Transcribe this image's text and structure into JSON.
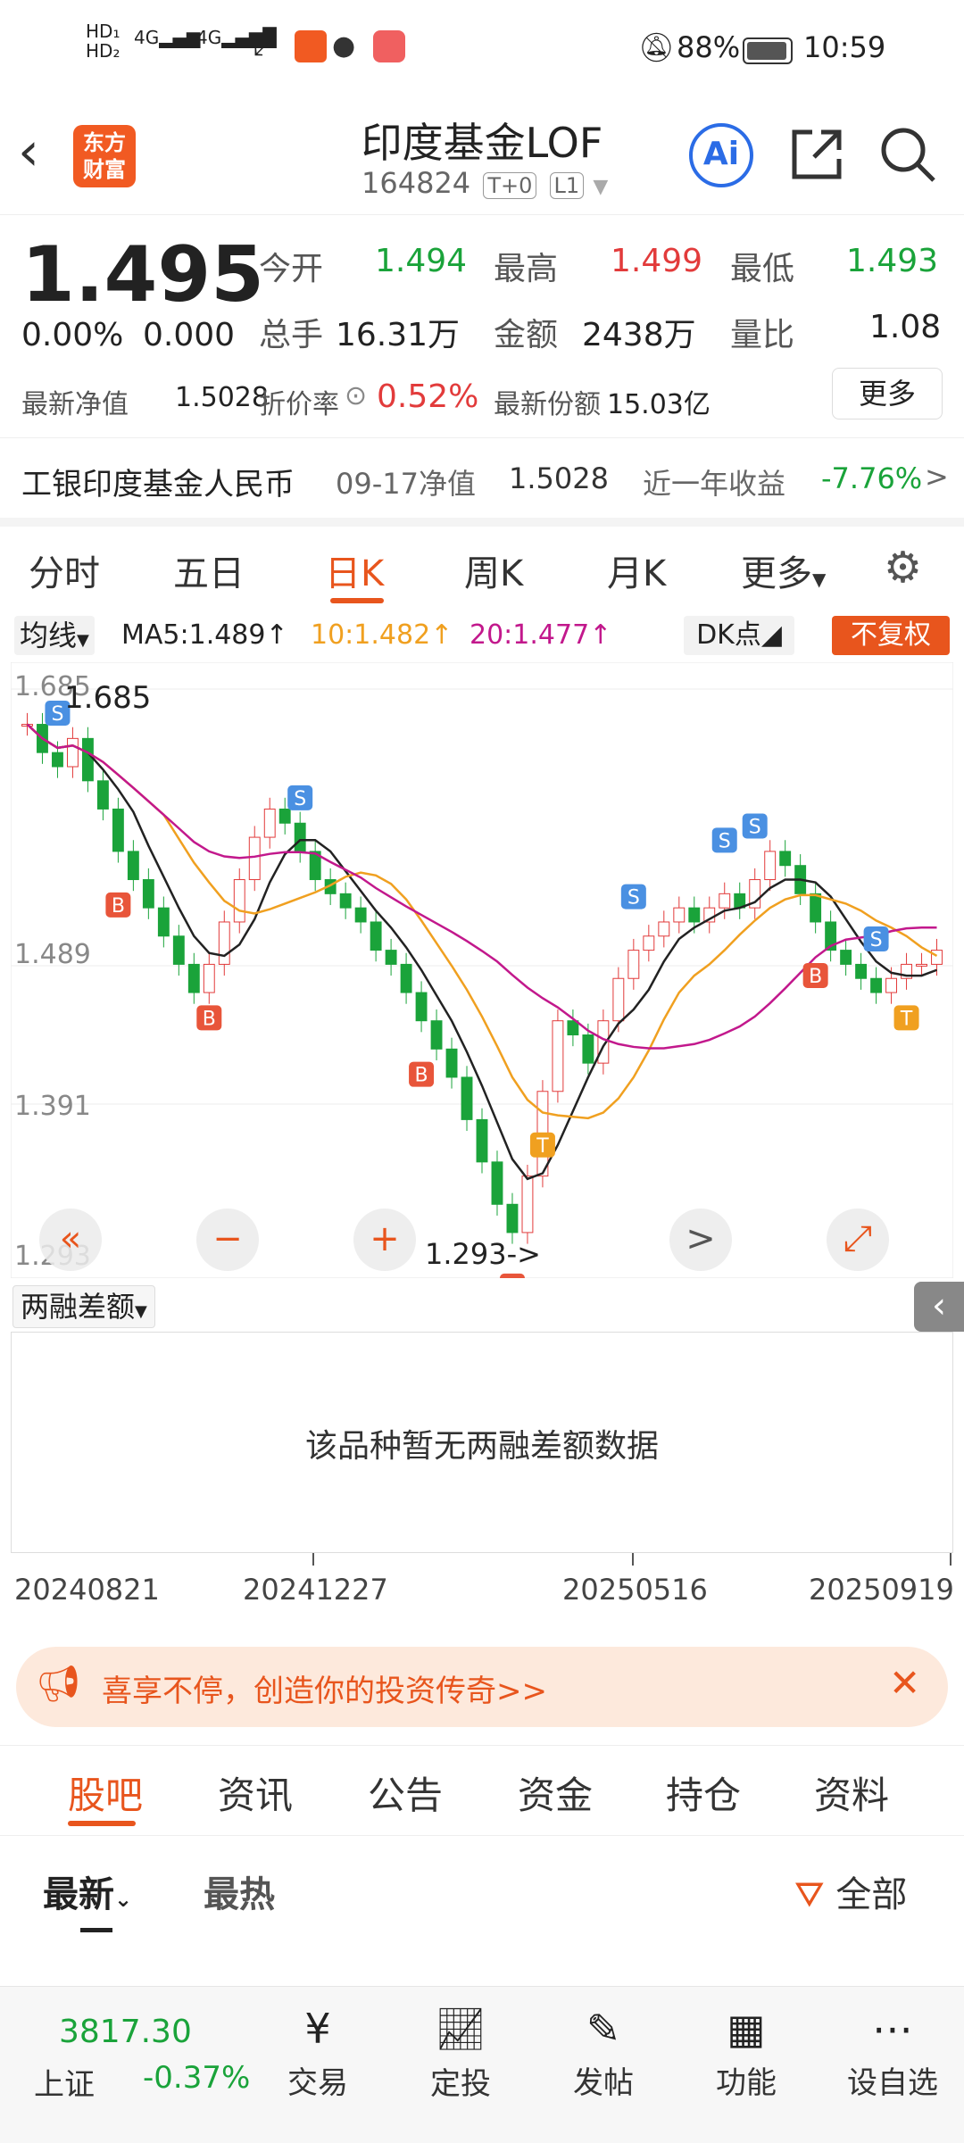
{
  "status": {
    "network": "4G",
    "network2": "4G",
    "battery": "88%",
    "time": "10:59"
  },
  "header": {
    "back": "back",
    "logo_line1": "东方",
    "logo_line2": "财富",
    "title": "印度基金LOF",
    "code": "164824",
    "tag1": "T+0",
    "tag2": "L1",
    "ai": "Ai"
  },
  "quote": {
    "price": "1.495",
    "change_pct": "0.00%",
    "change": "0.000",
    "open_label": "今开",
    "open": "1.494",
    "high_label": "最高",
    "high": "1.499",
    "low_label": "最低",
    "low": "1.493",
    "volume_label": "总手",
    "volume": "16.31万",
    "amount_label": "金额",
    "amount": "2438万",
    "ratio_label": "量比",
    "ratio": "1.08",
    "nav_label": "最新净值",
    "nav": "1.5028",
    "discount_label": "折价率",
    "discount": "0.52%",
    "shares_label": "最新份额",
    "shares": "15.03亿",
    "more": "更多"
  },
  "fund": {
    "name": "工银印度基金人民币",
    "date_label": "09-17净值",
    "nav": "1.5028",
    "year_label": "近一年收益",
    "year_return": "-7.76%",
    "arrow": ">"
  },
  "tabs": [
    "分时",
    "五日",
    "日K",
    "周K",
    "月K",
    "更多"
  ],
  "ma": {
    "toggle": "均线",
    "ma5": "MA5:1.489",
    "ma10": "10:1.482",
    "ma20": "20:1.477",
    "dk": "DK点",
    "adjust": "不复权",
    "colors": {
      "ma5": "#222222",
      "ma10": "#f0a020",
      "ma20": "#c2188c"
    }
  },
  "chart_data": {
    "type": "candlestick",
    "y_labels": [
      "1.685",
      "1.489",
      "1.391",
      "1.293"
    ],
    "high_marker": "1.685",
    "low_marker": "1.293->",
    "x_labels": [
      "20240821",
      "20241227",
      "20250516",
      "20250919"
    ],
    "markers": [
      "S",
      "B",
      "T"
    ],
    "close_series": [
      1.66,
      1.64,
      1.63,
      1.65,
      1.62,
      1.6,
      1.57,
      1.55,
      1.53,
      1.51,
      1.49,
      1.47,
      1.49,
      1.52,
      1.55,
      1.58,
      1.6,
      1.59,
      1.57,
      1.55,
      1.54,
      1.53,
      1.52,
      1.5,
      1.49,
      1.47,
      1.45,
      1.43,
      1.41,
      1.38,
      1.35,
      1.32,
      1.3,
      1.34,
      1.4,
      1.45,
      1.44,
      1.42,
      1.45,
      1.48,
      1.5,
      1.51,
      1.52,
      1.53,
      1.52,
      1.53,
      1.54,
      1.53,
      1.55,
      1.57,
      1.56,
      1.54,
      1.52,
      1.5,
      1.49,
      1.48,
      1.47,
      1.48,
      1.49,
      1.49,
      1.5
    ]
  },
  "zoom": {
    "first": "«",
    "minus": "−",
    "plus": "+",
    "next": ">",
    "expand": "⤢"
  },
  "margin": {
    "toggle": "两融差额",
    "empty": "该品种暂无两融差额数据"
  },
  "banner": {
    "text": "喜享不停，创造你的投资传奇>>",
    "close": "✕"
  },
  "section_tabs": [
    "股吧",
    "资讯",
    "公告",
    "资金",
    "持仓",
    "资料"
  ],
  "sort": {
    "latest": "最新",
    "hot": "最热",
    "filter": "全部"
  },
  "bottom": {
    "index_value": "3817.30",
    "index_name": "上证",
    "index_change": "-0.37%",
    "nav": [
      "交易",
      "定投",
      "发帖",
      "功能",
      "设自选"
    ]
  }
}
